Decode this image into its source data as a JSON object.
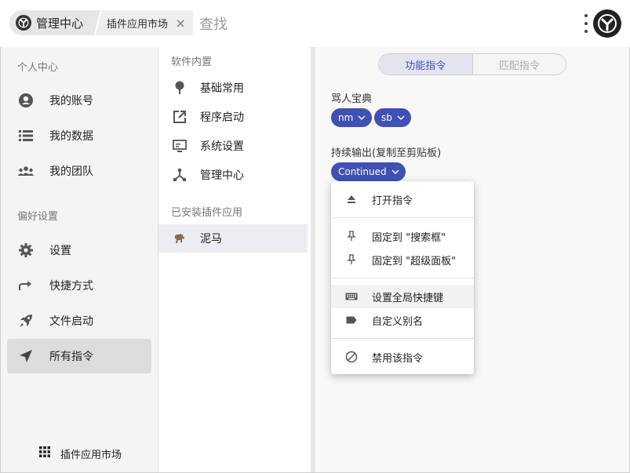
{
  "header": {
    "breadcrumb_main": "管理中心",
    "breadcrumb_sub": "插件应用市场",
    "close_glyph": "×",
    "search_placeholder": "查找",
    "icons": [
      "app-logo-icon",
      "more-vertical-icon",
      "close-icon"
    ]
  },
  "sidebar": {
    "group1_label": "个人中心",
    "group1_items": [
      {
        "label": "我的账号",
        "icon": "account-circle-icon"
      },
      {
        "label": "我的数据",
        "icon": "list-icon"
      },
      {
        "label": "我的团队",
        "icon": "team-icon"
      }
    ],
    "group2_label": "偏好设置",
    "group2_items": [
      {
        "label": "设置",
        "icon": "gear-icon"
      },
      {
        "label": "快捷方式",
        "icon": "share-arrow-icon"
      },
      {
        "label": "文件启动",
        "icon": "rocket-icon"
      },
      {
        "label": "所有指令",
        "icon": "send-icon",
        "active": true
      }
    ],
    "market_label": "插件应用市场"
  },
  "middle": {
    "group1_label": "软件内置",
    "group1_items": [
      {
        "label": "基础常用",
        "icon": "pin-icon"
      },
      {
        "label": "程序启动",
        "icon": "open-external-icon"
      },
      {
        "label": "系统设置",
        "icon": "monitor-settings-icon"
      },
      {
        "label": "管理中心",
        "icon": "hub-icon"
      }
    ],
    "group2_label": "已安装插件应用",
    "group2_items": [
      {
        "label": "泥马",
        "icon": "horse-icon",
        "active": true
      }
    ]
  },
  "right": {
    "tab_active": "功能指令",
    "tab_inactive": "匹配指令",
    "field1_label": "骂人宝典",
    "field1_chips": [
      "nm",
      "sb"
    ],
    "field2_label": "持续输出(复制至剪贴板)",
    "field2_chip": "Continued"
  },
  "context_menu": {
    "items": [
      {
        "label": "打开指令",
        "icon": "eject-icon"
      },
      {
        "label": "固定到 \"搜索框\"",
        "icon": "pin-outline-icon"
      },
      {
        "label": "固定到 \"超级面板\"",
        "icon": "pin-outline-icon"
      },
      {
        "label": "设置全局快捷键",
        "icon": "keyboard-icon",
        "highlighted": true
      },
      {
        "label": "自定义别名",
        "icon": "label-icon"
      },
      {
        "label": "禁用该指令",
        "icon": "block-icon"
      }
    ]
  },
  "colors": {
    "accent": "#3f51b5",
    "sidebar_bg": "#f4f4f4",
    "active_item_bg": "#dcdcdc"
  }
}
